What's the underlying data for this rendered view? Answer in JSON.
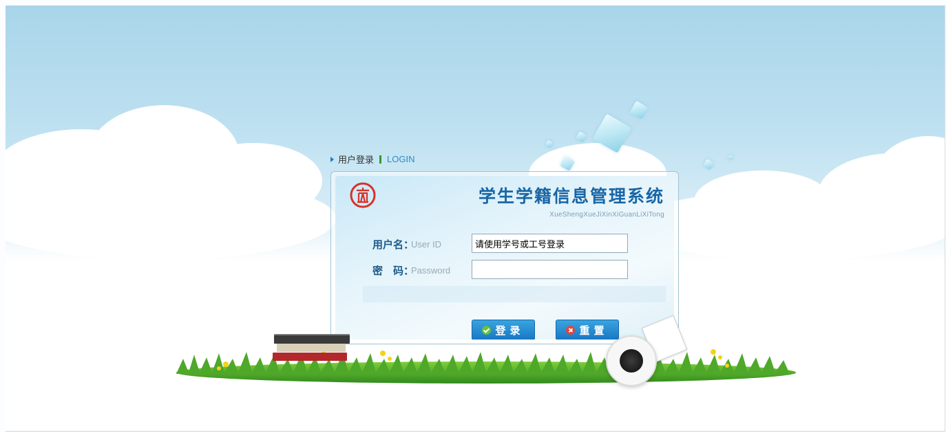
{
  "header": {
    "login_label_cn": "用户登录",
    "login_label_en": "LOGIN"
  },
  "system": {
    "title": "学生学籍信息管理系统",
    "subtitle": "XueShengXueJiXinXiGuanLiXiTong"
  },
  "form": {
    "username_label": "用户名：",
    "username_hint": "User ID",
    "username_value": "请使用学号或工号登录",
    "password_label": "密　码：",
    "password_hint": "Password",
    "password_value": ""
  },
  "buttons": {
    "login_label": "登录",
    "reset_label": "重置"
  },
  "colors": {
    "title": "#1866a6",
    "button": "#1878c4",
    "accent_green": "#2e9b2a"
  },
  "icons": [
    "triangle-bullet-icon",
    "school-logo-icon",
    "check-icon",
    "close-icon"
  ]
}
